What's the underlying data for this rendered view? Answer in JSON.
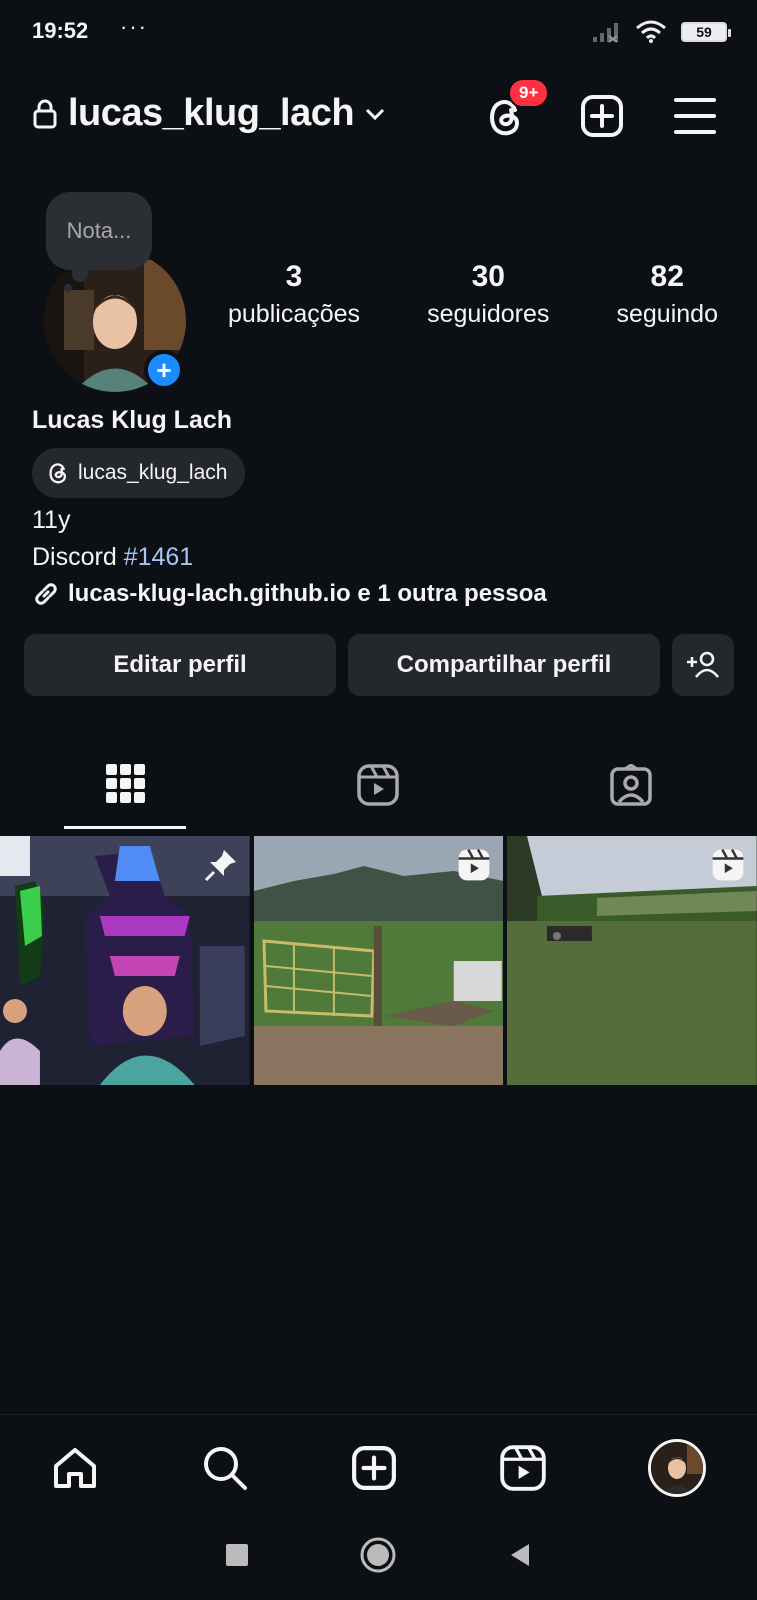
{
  "status_bar": {
    "time": "19:52",
    "dots": "···",
    "battery": "59"
  },
  "header": {
    "username": "lucas_klug_lach",
    "notification_badge": "9+"
  },
  "profile": {
    "note_placeholder": "Nota...",
    "stats": [
      {
        "value": "3",
        "label": "publicações"
      },
      {
        "value": "30",
        "label": "seguidores"
      },
      {
        "value": "82",
        "label": "seguindo"
      }
    ],
    "full_name": "Lucas Klug Lach",
    "threads_handle": "lucas_klug_lach",
    "bio_line1": "11y",
    "bio_line2_prefix": "Discord ",
    "bio_line2_hashtag": "#1461",
    "link_text": "lucas-klug-lach.github.io e 1 outra pessoa"
  },
  "actions": {
    "edit_profile": "Editar perfil",
    "share_profile": "Compartilhar perfil"
  },
  "colors": {
    "background": "#0c0f14",
    "button_bg": "#24272c",
    "accent_blue": "#1a8cff",
    "badge_red": "#ff3040",
    "hashtag": "#a7c7f2"
  },
  "icons": [
    "lock-icon",
    "chevron-down-icon",
    "threads-icon",
    "new-post-icon",
    "menu-icon",
    "link-icon",
    "add-person-icon",
    "grid-icon",
    "reels-icon",
    "tagged-icon",
    "pin-icon",
    "reel-badge-icon",
    "home-icon",
    "search-icon",
    "create-icon",
    "reels-nav-icon",
    "profile-avatar"
  ]
}
